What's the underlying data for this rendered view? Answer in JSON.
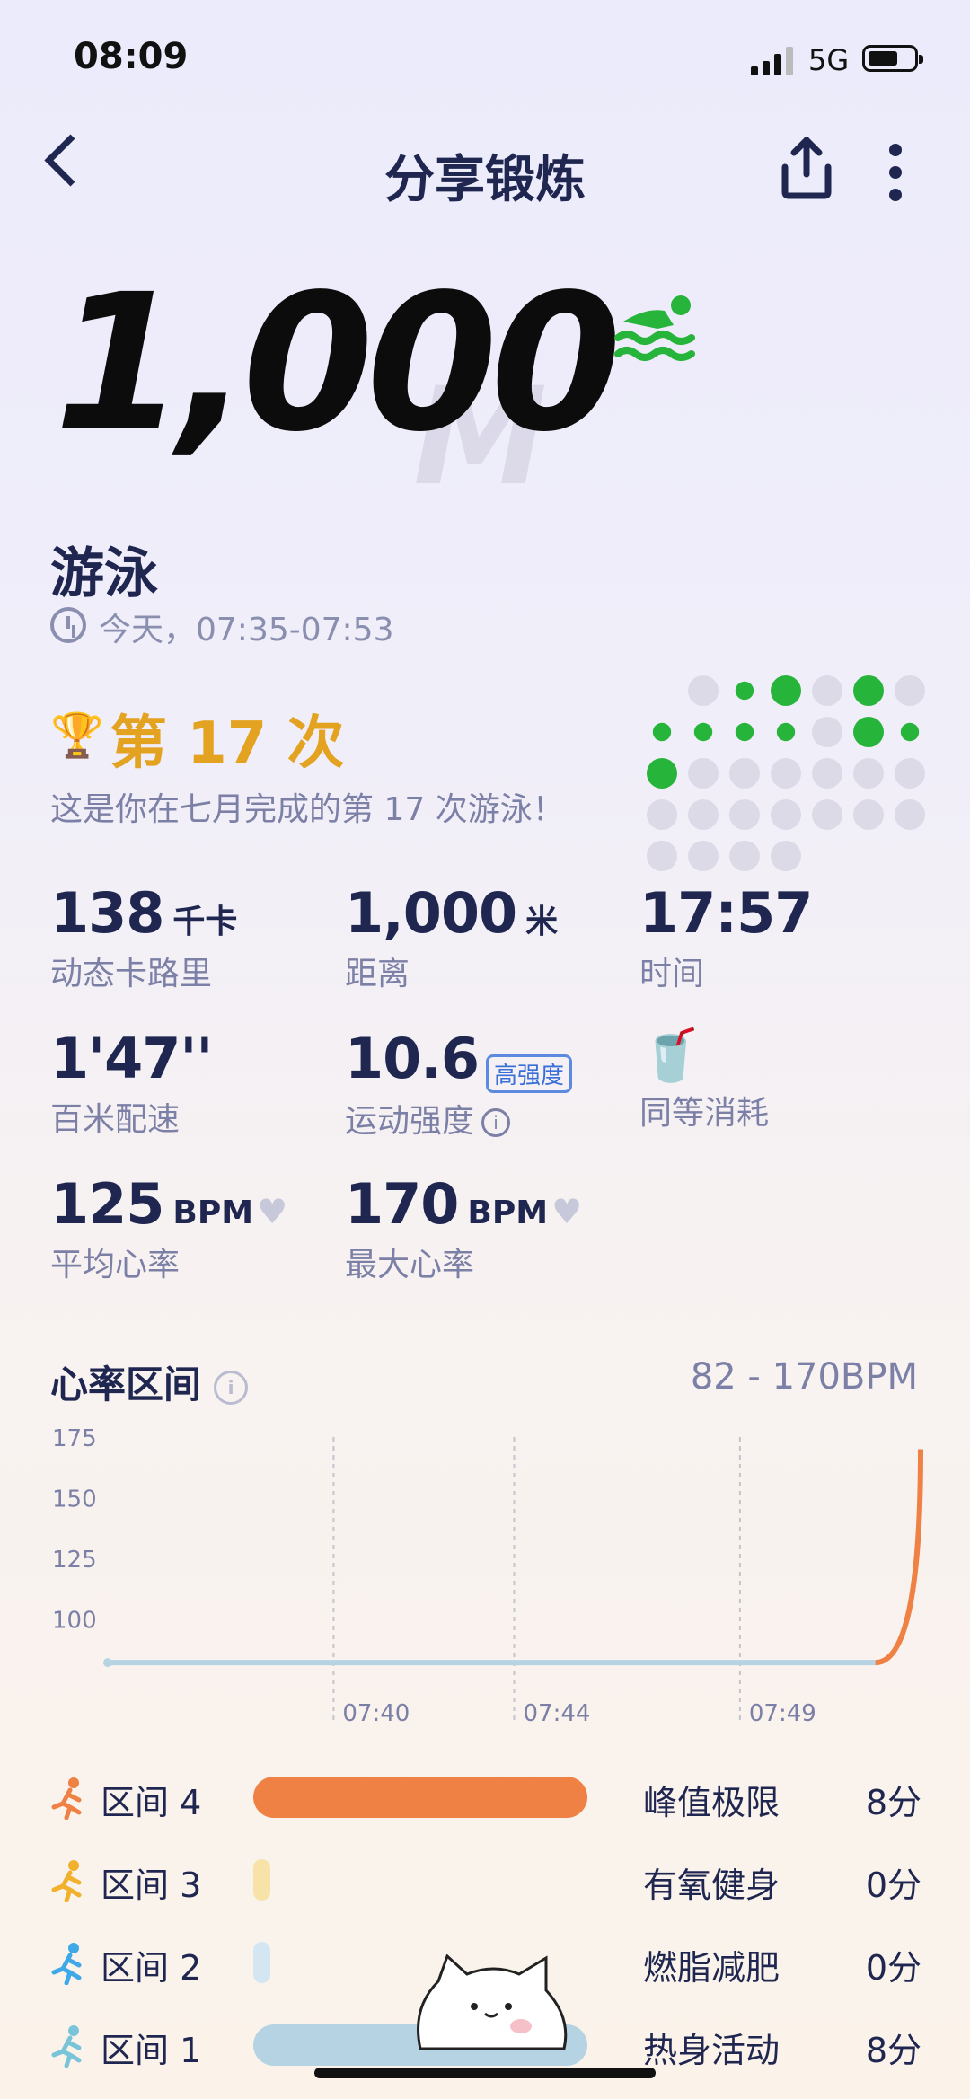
{
  "status": {
    "time": "08:09",
    "network": "5G"
  },
  "header": {
    "title": "分享锻炼"
  },
  "hero": {
    "distance": "1,000",
    "unit_ghost": "M",
    "sport": "游泳",
    "time_range": "今天，07:35-07:53"
  },
  "count": {
    "title": "第 17 次",
    "desc": "这是你在七月完成的第 17 次游泳！"
  },
  "stats": [
    {
      "value": "138",
      "unit": "千卡",
      "label": "动态卡路里"
    },
    {
      "value": "1,000",
      "unit": "米",
      "label": "距离"
    },
    {
      "value": "17:57",
      "unit": "",
      "label": "时间"
    },
    {
      "value": "1'47''",
      "unit": "",
      "label": "百米配速"
    },
    {
      "value": "10.6",
      "badge": "高强度",
      "label": "运动强度"
    },
    {
      "value": "",
      "unit": "",
      "label": "同等消耗"
    },
    {
      "value": "125",
      "unit": "BPM",
      "label": "平均心率"
    },
    {
      "value": "170",
      "unit": "BPM",
      "label": "最大心率"
    }
  ],
  "heart_rate": {
    "title": "心率区间",
    "range": "82 - 170BPM"
  },
  "chart_data": {
    "type": "line",
    "y_ticks": [
      "175",
      "150",
      "125",
      "100"
    ],
    "ylim": [
      75,
      175
    ],
    "x_ticks": [
      "07:40",
      "07:44",
      "07:49"
    ],
    "x": [
      "07:35",
      "07:40",
      "07:44",
      "07:49",
      "07:52",
      "07:53"
    ],
    "values": [
      82,
      82,
      82,
      82,
      82,
      170
    ],
    "grid": "vertical dashed",
    "colors": {
      "line": "#b5d3e3",
      "peak": "#ef8144"
    }
  },
  "zones": [
    {
      "name": "区间 4",
      "label": "峰值极限",
      "value": "8分",
      "fraction": 1.0,
      "color": "#ef8144",
      "icon_color": "#ef8144"
    },
    {
      "name": "区间 3",
      "label": "有氧健身",
      "value": "0分",
      "fraction": 0.05,
      "color": "#f7e2a8",
      "icon_color": "#f2b12c"
    },
    {
      "name": "区间 2",
      "label": "燃脂减肥",
      "value": "0分",
      "fraction": 0.05,
      "color": "#d4e6f1",
      "icon_color": "#3ea9e6"
    },
    {
      "name": "区间 1",
      "label": "热身活动",
      "value": "8分",
      "fraction": 1.0,
      "color": "#b5d3e3",
      "icon_color": "#7ac4d9"
    }
  ],
  "colors": {
    "accent_gold": "#e3a321",
    "swim_green": "#27b43a",
    "navy": "#1f2650"
  }
}
